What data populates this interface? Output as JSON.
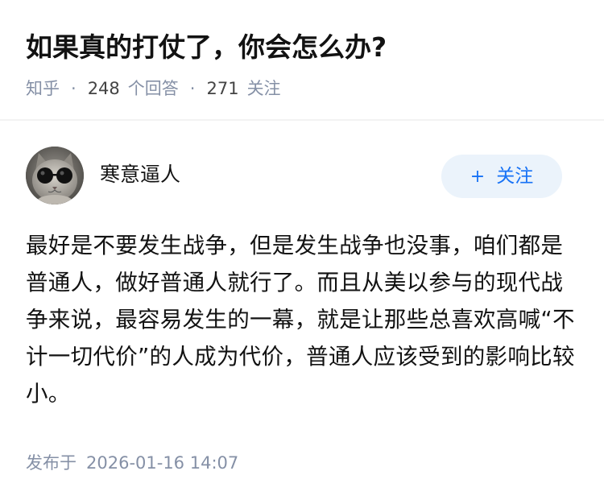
{
  "question": {
    "title": "如果真的打仗了，你会怎么办?",
    "source": "知乎",
    "answer_count": "248",
    "answer_label": "个回答",
    "follower_count": "271",
    "follower_label": "关注",
    "separator": "·"
  },
  "author": {
    "name": "寒意逼人",
    "avatar_icon": "cat-with-sunglasses-avatar",
    "follow_plus": "+",
    "follow_label": "关注"
  },
  "answer": {
    "text": "最好是不要发生战争，但是发生战争也没事，咱们都是普通人，做好普通人就行了。而且从美以参与的现代战争来说，最容易发生的一幕，就是让那些总喜欢高喊“不计一切代价”的人成为代价，普通人应该受到的影响比较小。"
  },
  "footer": {
    "published_label": "发布于",
    "published_time": "2026-01-16 14:07"
  },
  "colors": {
    "text": "#121212",
    "meta": "#8590a6",
    "accent": "#1772f6",
    "button_bg": "#ebf3fb"
  }
}
